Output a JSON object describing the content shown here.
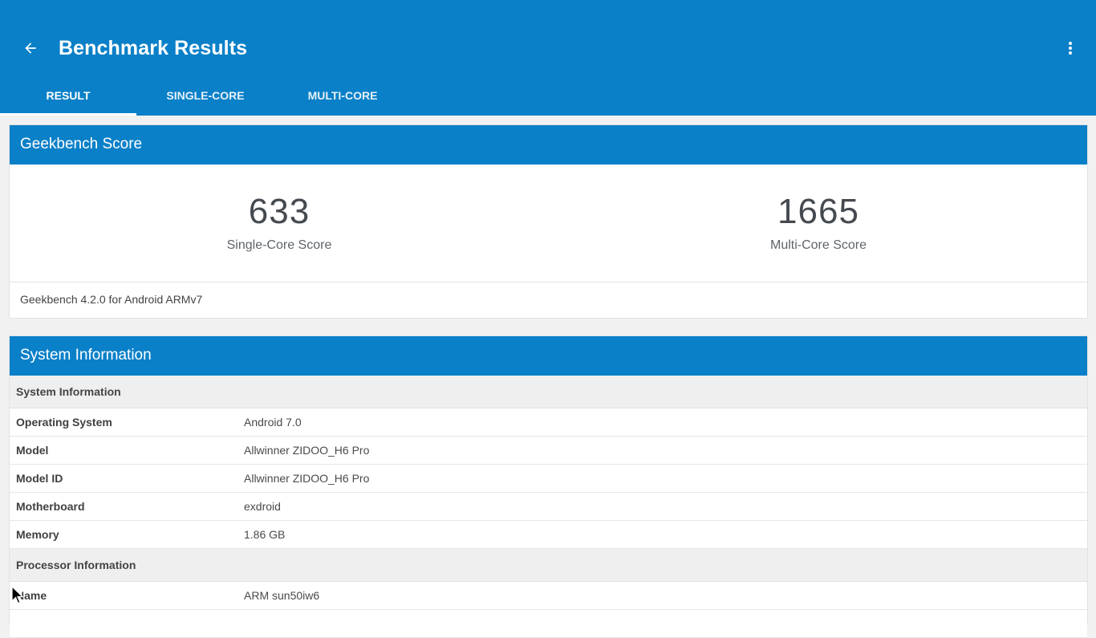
{
  "appbar": {
    "title": "Benchmark Results",
    "back_icon": "arrow-left-icon",
    "overflow_icon": "more-vert-icon",
    "background": "#0a80c8"
  },
  "tabs": [
    {
      "label": "RESULT",
      "active": true
    },
    {
      "label": "SINGLE-CORE",
      "active": false
    },
    {
      "label": "MULTI-CORE",
      "active": false
    }
  ],
  "score_card": {
    "header": "Geekbench Score",
    "single_core": {
      "value": "633",
      "label": "Single-Core Score"
    },
    "multi_core": {
      "value": "1665",
      "label": "Multi-Core Score"
    },
    "version": "Geekbench 4.2.0 for Android ARMv7"
  },
  "system_card": {
    "header": "System Information",
    "sections": [
      {
        "title": "System Information",
        "rows": [
          {
            "key": "Operating System",
            "value": "Android 7.0"
          },
          {
            "key": "Model",
            "value": "Allwinner ZIDOO_H6 Pro"
          },
          {
            "key": "Model ID",
            "value": "Allwinner ZIDOO_H6 Pro"
          },
          {
            "key": "Motherboard",
            "value": "exdroid"
          },
          {
            "key": "Memory",
            "value": "1.86 GB"
          }
        ]
      },
      {
        "title": "Processor Information",
        "rows": [
          {
            "key": "Name",
            "value": "ARM sun50iw6"
          }
        ]
      }
    ]
  }
}
